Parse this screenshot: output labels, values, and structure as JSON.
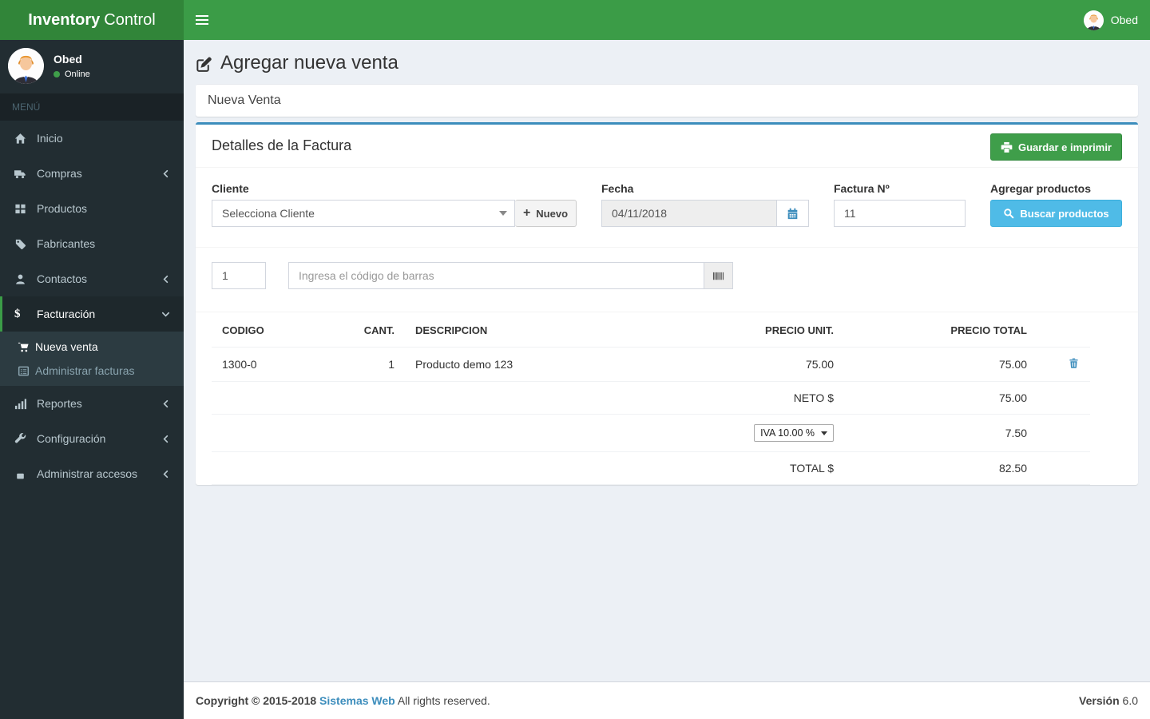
{
  "brand": {
    "bold": "Inventory",
    "normal": "Control"
  },
  "navbar": {
    "user_name": "Obed"
  },
  "sidebar": {
    "user": {
      "name": "Obed",
      "status": "Online"
    },
    "menu_header": "MENÚ",
    "items": [
      {
        "label": "Inicio",
        "icon": "home-icon"
      },
      {
        "label": "Compras",
        "icon": "truck-icon"
      },
      {
        "label": "Productos",
        "icon": "grid-icon"
      },
      {
        "label": "Fabricantes",
        "icon": "tag-icon"
      },
      {
        "label": "Contactos",
        "icon": "user-icon"
      },
      {
        "label": "Facturación",
        "icon": "dollar-icon",
        "active": true
      },
      {
        "label": "Reportes",
        "icon": "bar-chart-icon"
      },
      {
        "label": "Configuración",
        "icon": "wrench-icon"
      },
      {
        "label": "Administrar accesos",
        "icon": "lock-icon"
      }
    ],
    "submenu": [
      {
        "label": "Nueva venta",
        "icon": "cart-icon",
        "active": true
      },
      {
        "label": "Administrar facturas",
        "icon": "list-icon"
      }
    ],
    "dollar_glyph": "$"
  },
  "page": {
    "title": "Agregar nueva venta"
  },
  "box1": {
    "title": "Nueva Venta"
  },
  "invoice": {
    "section_title": "Detalles de la Factura",
    "save_button": "Guardar e imprimir",
    "fields": {
      "cliente_label": "Cliente",
      "cliente_value": "Selecciona Cliente",
      "nuevo_plus": "+",
      "nuevo_button": "Nuevo",
      "fecha_label": "Fecha",
      "fecha_value": "04/11/2018",
      "factura_label": "Factura Nº",
      "factura_value": "11",
      "agregar_label": "Agregar productos",
      "buscar_button": "Buscar productos"
    },
    "barcode": {
      "qty": "1",
      "placeholder": "Ingresa el código de barras"
    },
    "table": {
      "headers": [
        "CODIGO",
        "CANT.",
        "DESCRIPCION",
        "PRECIO UNIT.",
        "PRECIO TOTAL"
      ],
      "rows": [
        {
          "codigo": "1300-0",
          "cant": "1",
          "descripcion": "Producto demo 123",
          "precio_unit": "75.00",
          "precio_total": "75.00"
        }
      ],
      "neto_label": "NETO $",
      "neto_value": "75.00",
      "iva_selected": "IVA 10.00 %",
      "iva_value": "7.50",
      "total_label": "TOTAL $",
      "total_value": "82.50"
    }
  },
  "footer": {
    "copyright": "Copyright © 2015-2018",
    "link": "Sistemas Web",
    "rights": "All rights reserved.",
    "version_label": "Versión",
    "version_value": "6.0"
  }
}
